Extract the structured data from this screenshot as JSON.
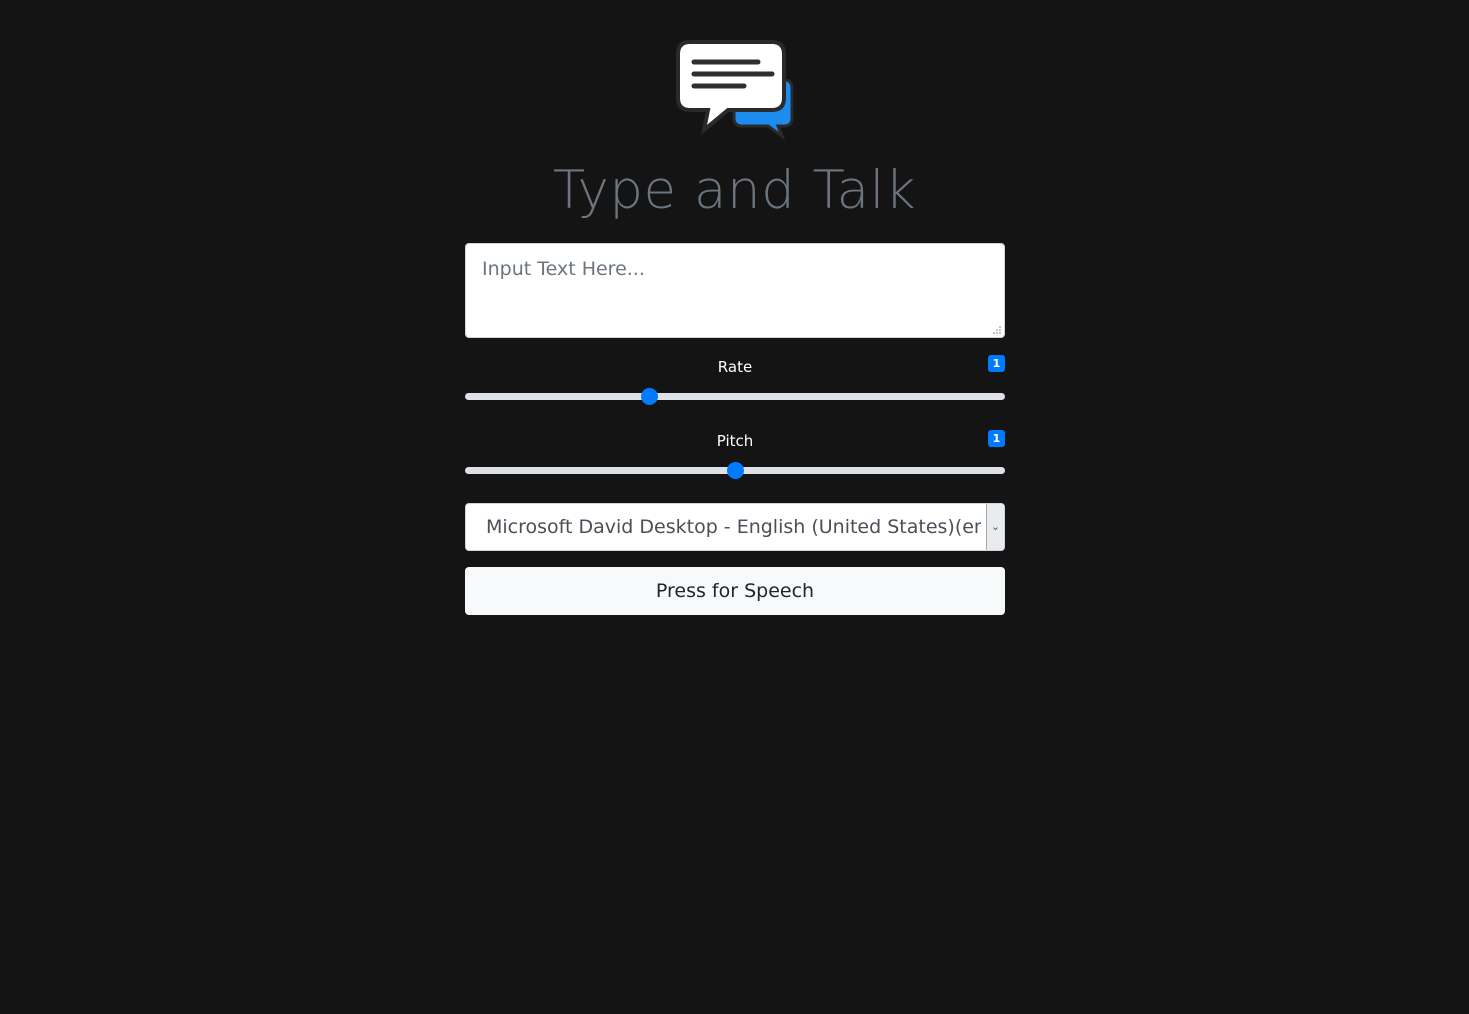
{
  "app": {
    "title": "Type and Talk",
    "logo_icon": "speech-bubbles-icon",
    "accent_color": "#007bff",
    "background_color": "#141414"
  },
  "text_input": {
    "placeholder": "Input Text Here...",
    "value": ""
  },
  "rate": {
    "label": "Rate",
    "value": "1",
    "position": 0.34
  },
  "pitch": {
    "label": "Pitch",
    "value": "1",
    "position": 0.5
  },
  "voice_select": {
    "selected": "Microsoft David Desktop - English (United States)(en-US)",
    "arrow_icon": "chevron-down-icon"
  },
  "speak_button": {
    "label": "Press for Speech"
  }
}
